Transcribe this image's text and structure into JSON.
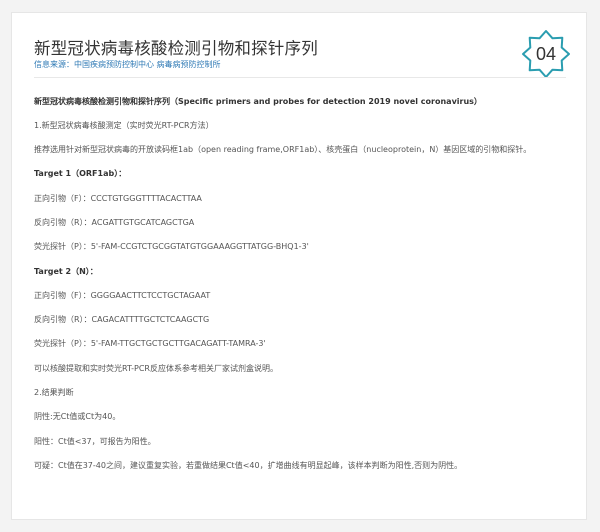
{
  "title": "新型冠状病毒核酸检测引物和探针序列",
  "source": "信息来源：中国疾病预防控制中心 病毒病预防控制所",
  "badge": "04",
  "lines": [
    "新型冠状病毒核酸检测引物和探针序列（Specific primers and probes for detection 2019 novel coronavirus）",
    "1.新型冠状病毒核酸测定（实时荧光RT-PCR方法）",
    "推荐选用针对新型冠状病毒的开放读码框1ab（open reading frame,ORF1ab）、核壳蛋白（nucleoprotein，N）基因区域的引物和探针。",
    "Target 1（ORF1ab）：",
    "正向引物（F）：CCCTGTGGGTTTTACACTTAA",
    "反向引物（R）：ACGATTGTGCATCAGCTGA",
    "荧光探针（P）：5'-FAM-CCGTCTGCGGTATGTGGAAAGGTTATGG-BHQ1-3'",
    "Target 2（N）：",
    "正向引物（F）：GGGGAACTTCTCCTGCTAGAAT",
    "反向引物（R）：CAGACATTTTGCTCTCAAGCTG",
    "荧光探针（P）：5'-FAM-TTGCTGCTGCTTGACAGATT-TAMRA-3'",
    "可以核酸提取和实时荧光RT-PCR反应体系参考相关厂家试剂盒说明。",
    "2.结果判断",
    "阴性:无Ct值或Ct为40。",
    "阳性：Ct值<37，可报告为阳性。",
    "可疑：Ct值在37-40之间，建议重复实验，若重做结果Ct值<40，扩增曲线有明显起峰，该样本判断为阳性,否则为阴性。"
  ]
}
